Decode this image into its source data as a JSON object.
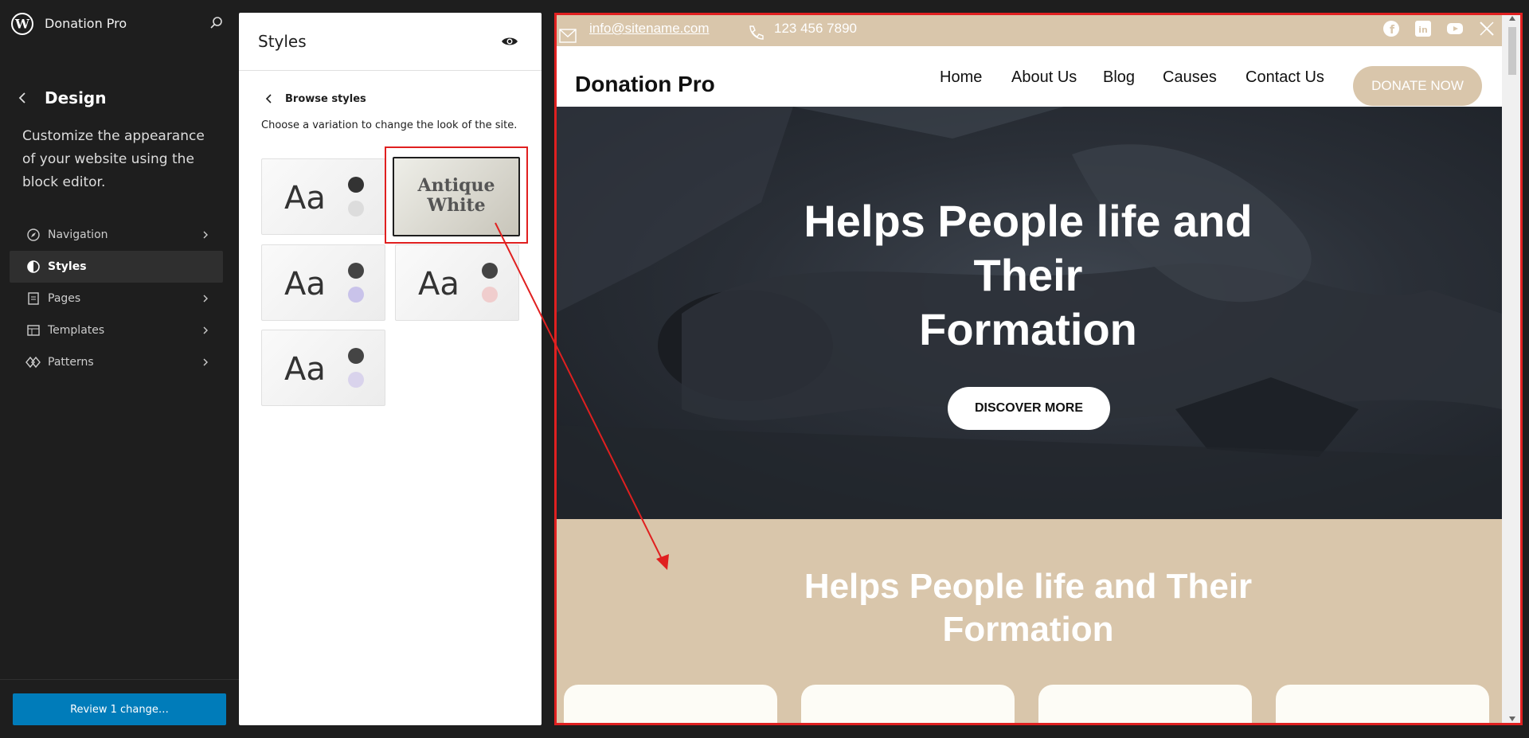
{
  "sidebar": {
    "site_name": "Donation Pro",
    "section_title": "Design",
    "description": "Customize the appearance of your website using the block editor.",
    "items": [
      {
        "label": "Navigation",
        "icon": "navigation-icon"
      },
      {
        "label": "Styles",
        "icon": "styles-icon",
        "active": true
      },
      {
        "label": "Pages",
        "icon": "pages-icon"
      },
      {
        "label": "Templates",
        "icon": "templates-icon"
      },
      {
        "label": "Patterns",
        "icon": "patterns-icon"
      }
    ],
    "review_button": "Review 1 change…"
  },
  "styles_panel": {
    "title": "Styles",
    "browse_label": "Browse styles",
    "browse_description": "Choose a variation to change the look of the site.",
    "variations": [
      {
        "label": "Aa",
        "colors": [
          "#333333",
          "#dcdcdc"
        ]
      },
      {
        "label": "Antique White",
        "line1": "Antique",
        "line2": "White",
        "selected": true
      },
      {
        "label": "Aa",
        "colors": [
          "#444444",
          "#c9c3ea"
        ]
      },
      {
        "label": "Aa",
        "colors": [
          "#444444",
          "#f0cdcd"
        ]
      },
      {
        "label": "Aa",
        "colors": [
          "#444444",
          "#d9d3ec"
        ]
      }
    ]
  },
  "preview": {
    "topbar": {
      "email": "info@sitename.com",
      "phone": "123 456 7890",
      "socials": [
        "facebook-icon",
        "linkedin-icon",
        "youtube-icon",
        "x-icon"
      ]
    },
    "brand": "Donation Pro",
    "menu": [
      "Home",
      "About Us",
      "Blog",
      "Causes",
      "Contact Us"
    ],
    "donate_button": "DONATE NOW",
    "hero": {
      "title_line1": "Helps People life and",
      "title_line2": "Their",
      "title_line3": "Formation",
      "button": "DISCOVER MORE"
    },
    "section2": {
      "title_line1": "Helps People life and Their",
      "title_line2": "Formation"
    }
  },
  "colors": {
    "accent": "#d9c6ab",
    "wp_blue": "#007cba",
    "annotation_red": "#e02020",
    "sidebar_bg": "#1e1e1e"
  }
}
